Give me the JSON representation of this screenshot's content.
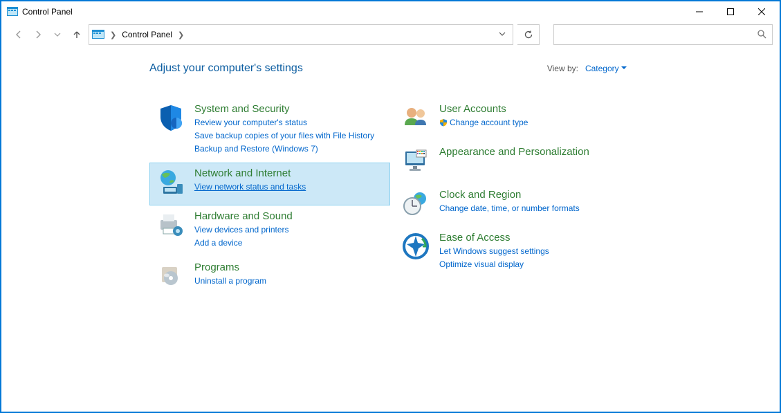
{
  "window": {
    "title": "Control Panel"
  },
  "breadcrumb": {
    "root": "Control Panel"
  },
  "search": {
    "placeholder": ""
  },
  "header": {
    "heading": "Adjust your computer's settings",
    "viewby_label": "View by:",
    "viewby_mode": "Category"
  },
  "left": [
    {
      "id": "system-security",
      "title": "System and Security",
      "links": [
        "Review your computer's status",
        "Save backup copies of your files with File History",
        "Backup and Restore (Windows 7)"
      ],
      "selected": false
    },
    {
      "id": "network-internet",
      "title": "Network and Internet",
      "links": [
        "View network status and tasks"
      ],
      "selected": true
    },
    {
      "id": "hardware-sound",
      "title": "Hardware and Sound",
      "links": [
        "View devices and printers",
        "Add a device"
      ],
      "selected": false
    },
    {
      "id": "programs",
      "title": "Programs",
      "links": [
        "Uninstall a program"
      ],
      "selected": false
    }
  ],
  "right": [
    {
      "id": "user-accounts",
      "title": "User Accounts",
      "links": [
        "Change account type"
      ],
      "shield_on_first": true
    },
    {
      "id": "appearance-personalization",
      "title": "Appearance and Personalization",
      "links": []
    },
    {
      "id": "clock-region",
      "title": "Clock and Region",
      "links": [
        "Change date, time, or number formats"
      ]
    },
    {
      "id": "ease-of-access",
      "title": "Ease of Access",
      "links": [
        "Let Windows suggest settings",
        "Optimize visual display"
      ]
    }
  ]
}
